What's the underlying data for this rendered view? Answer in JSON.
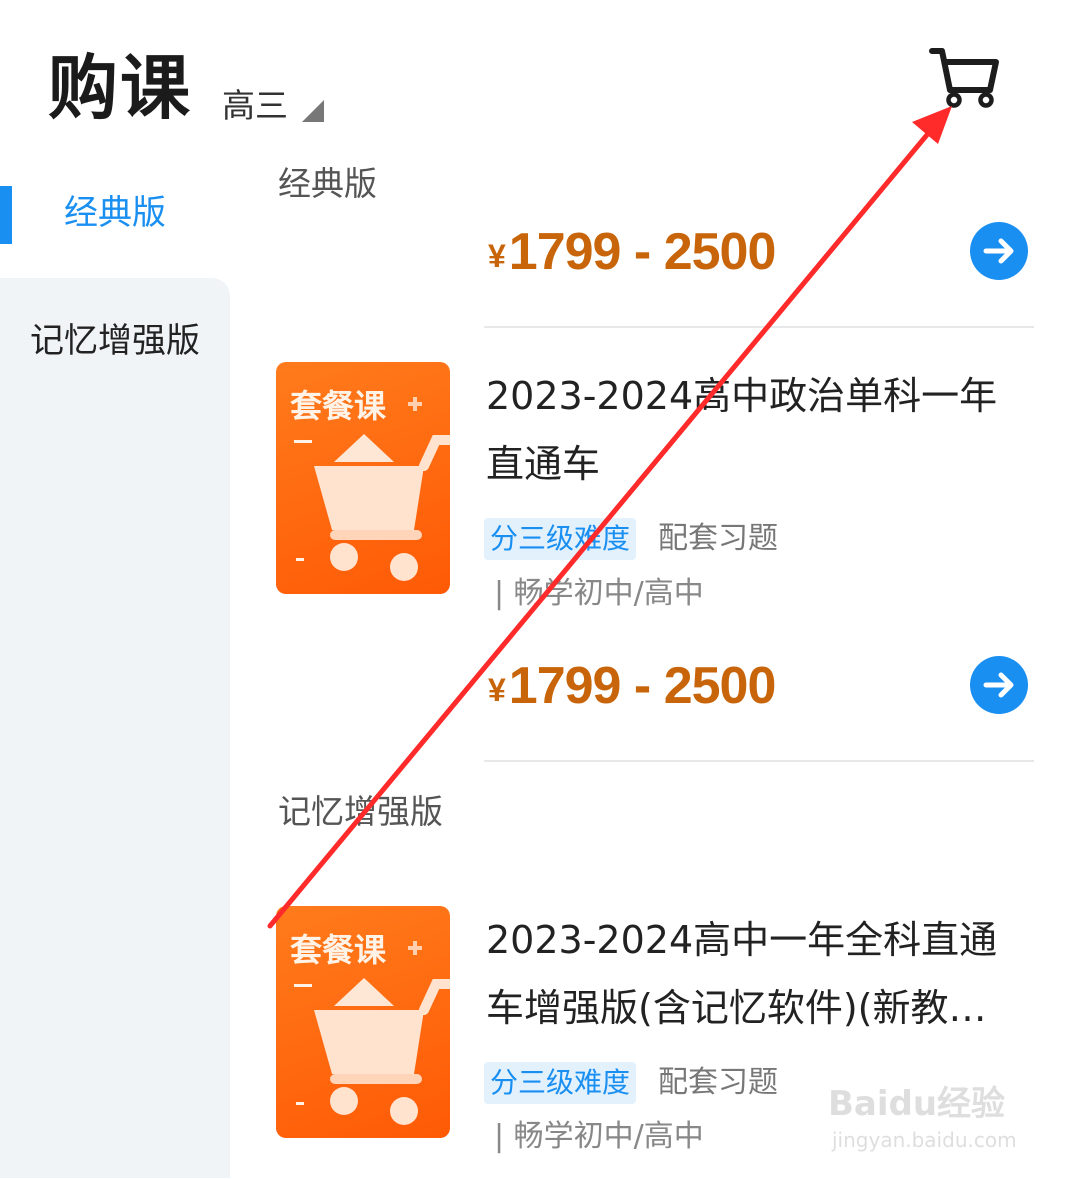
{
  "header": {
    "title": "购课",
    "grade": "高三"
  },
  "sidebar": {
    "items": [
      {
        "label": "经典版",
        "active": true
      },
      {
        "label": "记忆增强版",
        "active": false
      }
    ]
  },
  "sections": [
    {
      "heading": "经典版"
    },
    {
      "heading": "记忆增强版"
    }
  ],
  "courses": [
    {
      "price_symbol": "¥",
      "price_range": "1799 - 2500"
    },
    {
      "thumb_label": "套餐课",
      "title": "2023-2024高中政治单科一年直通车",
      "tag_primary": "分三级难度",
      "tag_secondary": "配套习题",
      "provider": "| 畅学初中/高中",
      "price_symbol": "¥",
      "price_range": "1799 - 2500"
    },
    {
      "thumb_label": "套餐课",
      "title": "2023-2024高中一年全科直通车增强版(含记忆软件)(新教…",
      "tag_primary": "分三级难度",
      "tag_secondary": "配套习题",
      "provider": "| 畅学初中/高中"
    }
  ],
  "watermark": {
    "brand": "Baidu经验",
    "url": "jingyan.baidu.com"
  },
  "colors": {
    "accent": "#1a8ff2",
    "price": "#c8650a",
    "thumb": "#ff6a10",
    "annotation": "#ff2a2a"
  },
  "icons": [
    "shopping-cart-icon",
    "caret-down-icon",
    "arrow-right-icon",
    "cart-illustration"
  ]
}
